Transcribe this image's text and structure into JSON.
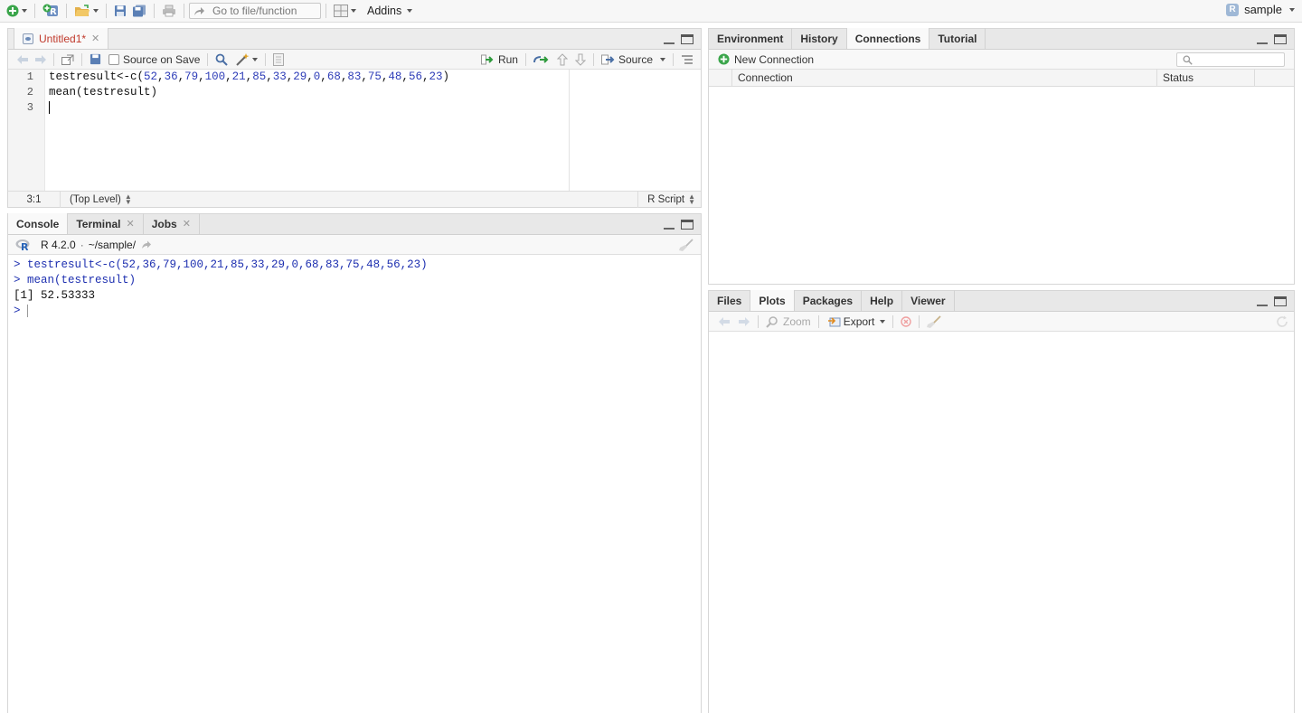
{
  "toolbar": {
    "goto_placeholder": "Go to file/function",
    "addins_label": "Addins",
    "project_label": "sample"
  },
  "source": {
    "file_tab": "Untitled1*",
    "source_on_save": "Source on Save",
    "run_label": "Run",
    "source_label": "Source",
    "line_numbers": [
      "1",
      "2",
      "3"
    ],
    "status_position": "3:1",
    "status_scope": "(Top Level)",
    "status_type": "R Script"
  },
  "console": {
    "tabs": [
      "Console",
      "Terminal",
      "Jobs"
    ],
    "r_version": "R 4.2.0",
    "path": "~/sample/",
    "lines": [
      {
        "kind": "cmd",
        "text": "> testresult<-c(52,36,79,100,21,85,33,29,0,68,83,75,48,56,23)"
      },
      {
        "kind": "cmd",
        "text": "> mean(testresult)"
      },
      {
        "kind": "out",
        "text": "[1] 52.53333"
      },
      {
        "kind": "cmd",
        "text": "> "
      }
    ]
  },
  "editor_code": {
    "line1_prefix": "testresult<-c(",
    "line1_numbers": [
      "52",
      "36",
      "79",
      "100",
      "21",
      "85",
      "33",
      "29",
      "0",
      "68",
      "83",
      "75",
      "48",
      "56",
      "23"
    ],
    "line1_suffix": ")",
    "line2": "mean(testresult)"
  },
  "connections": {
    "tabs": [
      "Environment",
      "History",
      "Connections",
      "Tutorial"
    ],
    "active_tab": "Connections",
    "new_connection_label": "New Connection",
    "columns": [
      "Connection",
      "Status"
    ]
  },
  "plots": {
    "tabs": [
      "Files",
      "Plots",
      "Packages",
      "Help",
      "Viewer"
    ],
    "active_tab": "Plots",
    "zoom_label": "Zoom",
    "export_label": "Export"
  },
  "colors": {
    "code_number": "#2e3db8",
    "console_command": "#1d2fb0",
    "file_tab_modified": "#c0392b"
  }
}
